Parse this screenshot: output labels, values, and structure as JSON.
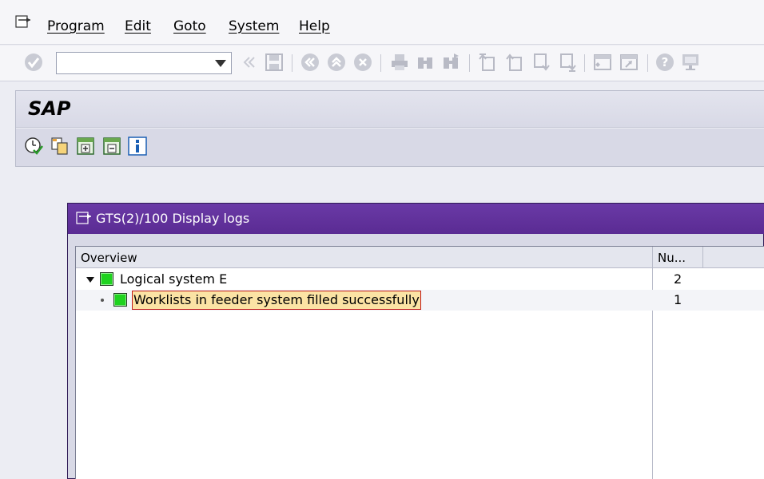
{
  "menubar": {
    "items": [
      {
        "label": "Program"
      },
      {
        "label": "Edit"
      },
      {
        "label": "Goto"
      },
      {
        "label": "System"
      },
      {
        "label": "Help"
      }
    ]
  },
  "toolbar": {
    "command_field": {
      "value": "",
      "placeholder": ""
    }
  },
  "header": {
    "title": "SAP"
  },
  "dialog": {
    "title": "GTS(2)/100 Display logs",
    "columns": [
      {
        "label": "Overview"
      },
      {
        "label": "Nu..."
      }
    ],
    "rows": [
      {
        "text": "Logical system E",
        "count": "2",
        "status_color": "#1fd31f",
        "expanded": true
      },
      {
        "text": "Worklists in feeder system filled successfully",
        "count": "1",
        "status_color": "#1fd31f",
        "selected": true
      }
    ]
  }
}
